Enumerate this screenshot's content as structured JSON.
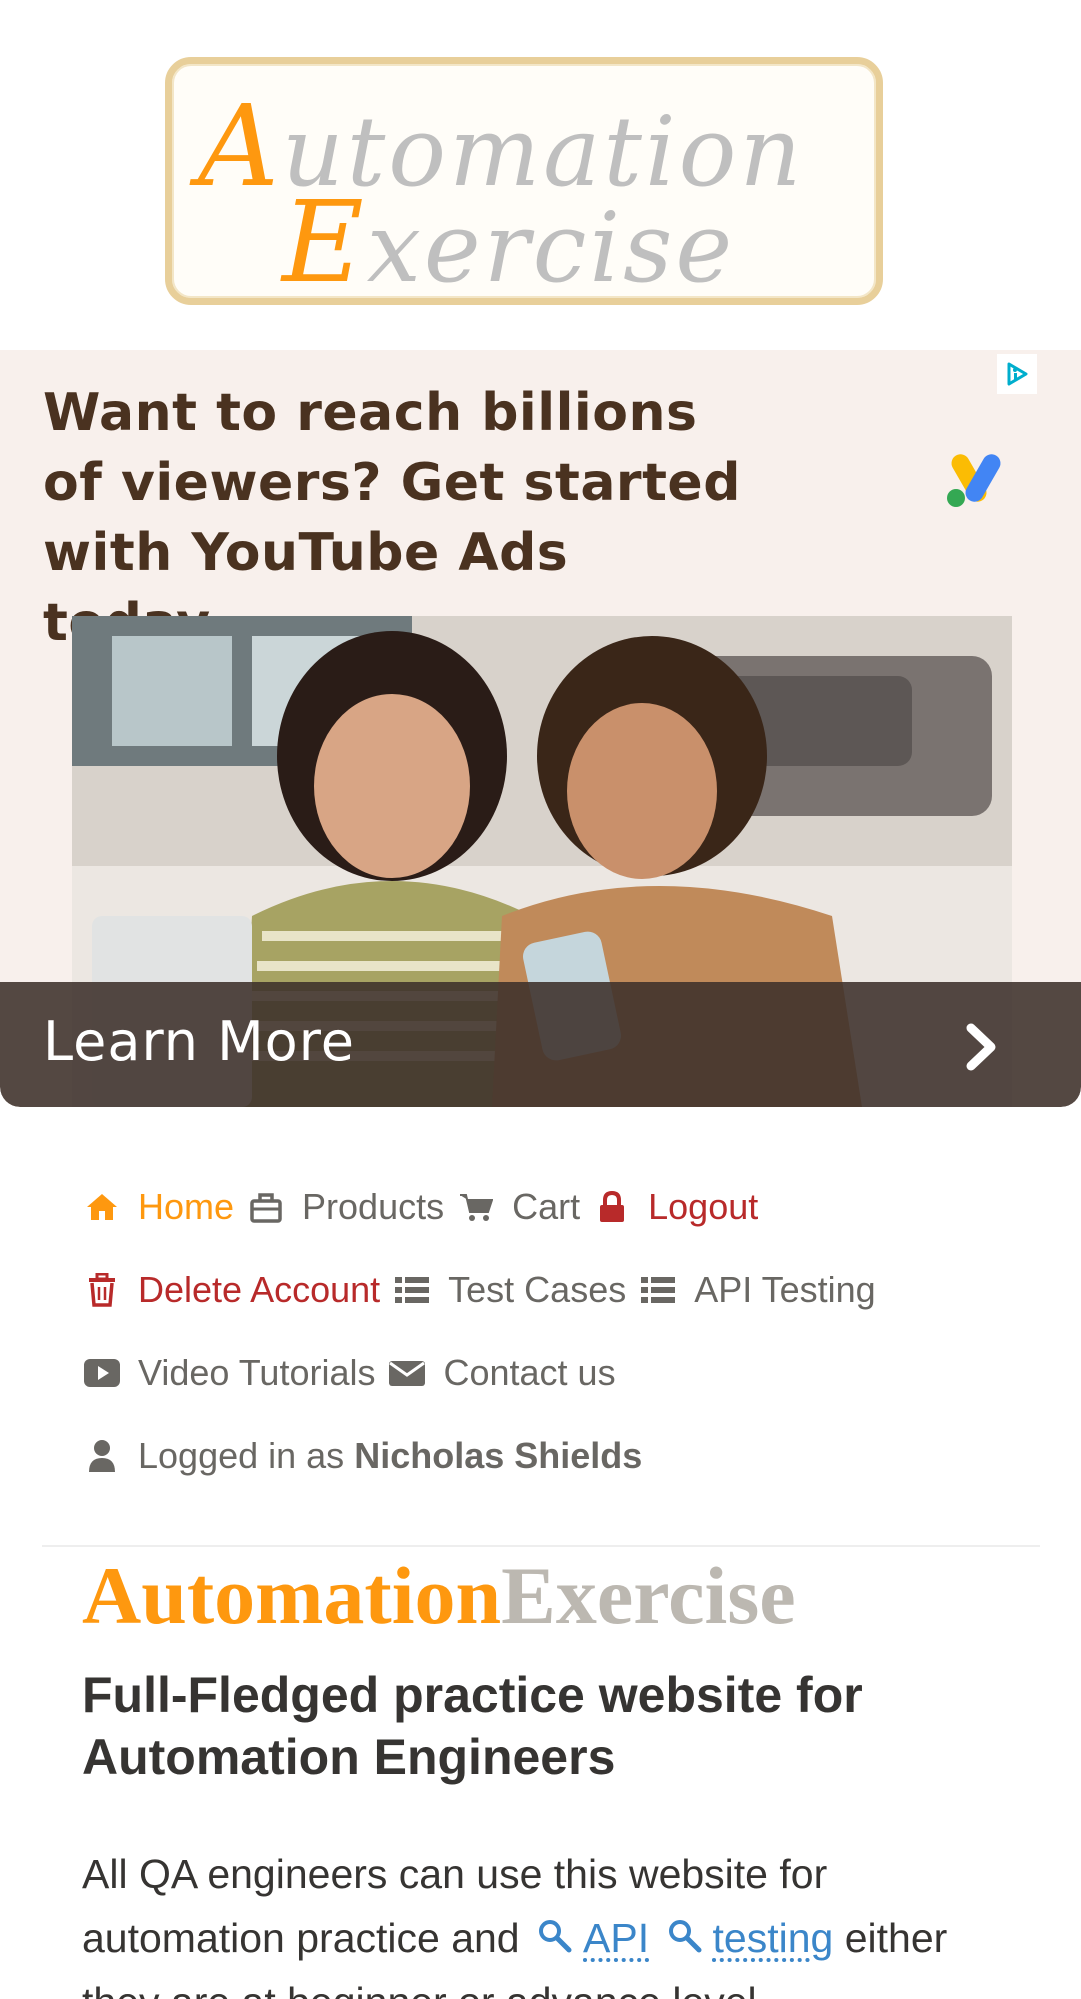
{
  "logo": {
    "line1_cap": "A",
    "line1_rest": "utomation",
    "line2_cap": "E",
    "line2_rest": "xercise"
  },
  "ad": {
    "headline": "Want to reach billions of viewers? Get started with YouTube Ads today.",
    "cta_label": "Learn More",
    "choices_icon": "adchoices-icon",
    "logo_icon": "google-ads-icon",
    "background": "#f8f0ec",
    "headline_color": "#4a3220"
  },
  "nav": {
    "home": "Home",
    "products": "Products",
    "cart": "Cart",
    "logout": "Logout",
    "delete_account": "Delete Account",
    "test_cases": "Test Cases",
    "api_testing": "API Testing",
    "video_tutorials": "Video Tutorials",
    "contact_us": "Contact us",
    "logged_in_prefix": "Logged in as",
    "logged_in_user": "Nicholas Shields"
  },
  "hero": {
    "brand_a": "Automation",
    "brand_b": "Exercise",
    "title": "Full-Fledged practice website for Automation Engineers",
    "body_prefix": "All QA engineers can use this website for automation practice and",
    "link_api": "API",
    "link_testing": "testing",
    "body_suffix": "either they are at beginner or advance level."
  },
  "colors": {
    "accent": "#fe980f",
    "danger": "#b82a2a",
    "text": "#696763",
    "link": "#3b86c9"
  }
}
